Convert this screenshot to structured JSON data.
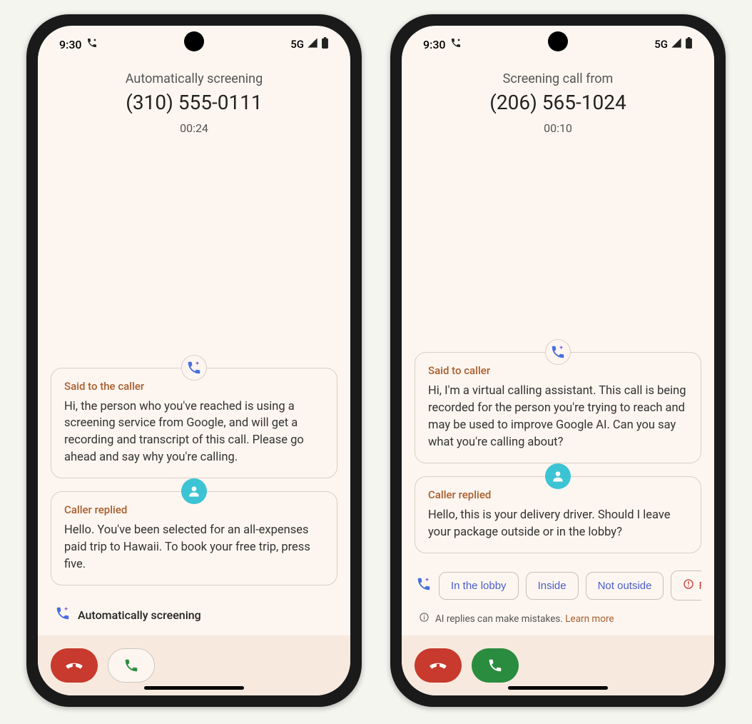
{
  "phones": {
    "left": {
      "status_time": "9:30",
      "network": "5G",
      "header_label": "Automatically screening",
      "phone_number": "(310) 555-0111",
      "timer": "00:24",
      "said_title": "Said to the caller",
      "said_text": "Hi, the person who you've reached is using a screening service from Google, and will get a recording and transcript of this call. Please go ahead and say why you're calling.",
      "reply_title": "Caller replied",
      "reply_text": "Hello. You've been selected for an all-expenses paid trip to Hawaii. To book your free trip, press five.",
      "auto_screening_label": "Automatically screening"
    },
    "right": {
      "status_time": "9:30",
      "network": "5G",
      "header_label": "Screening call from",
      "phone_number": "(206) 565-1024",
      "timer": "00:10",
      "said_title": "Said to caller",
      "said_text": "Hi, I'm a virtual calling assistant. This call is being recorded for the person you're trying to reach and may be used to improve Google AI. Can you say what you're calling about?",
      "reply_title": "Caller replied",
      "reply_text": "Hello, this is your delivery driver. Should I leave your package outside or in the lobby?",
      "chips": {
        "0": "In the lobby",
        "1": "Inside",
        "2": "Not outside",
        "3": "Rep"
      },
      "disclaimer_text": "AI replies can make mistakes.",
      "disclaimer_link": "Learn more"
    }
  }
}
